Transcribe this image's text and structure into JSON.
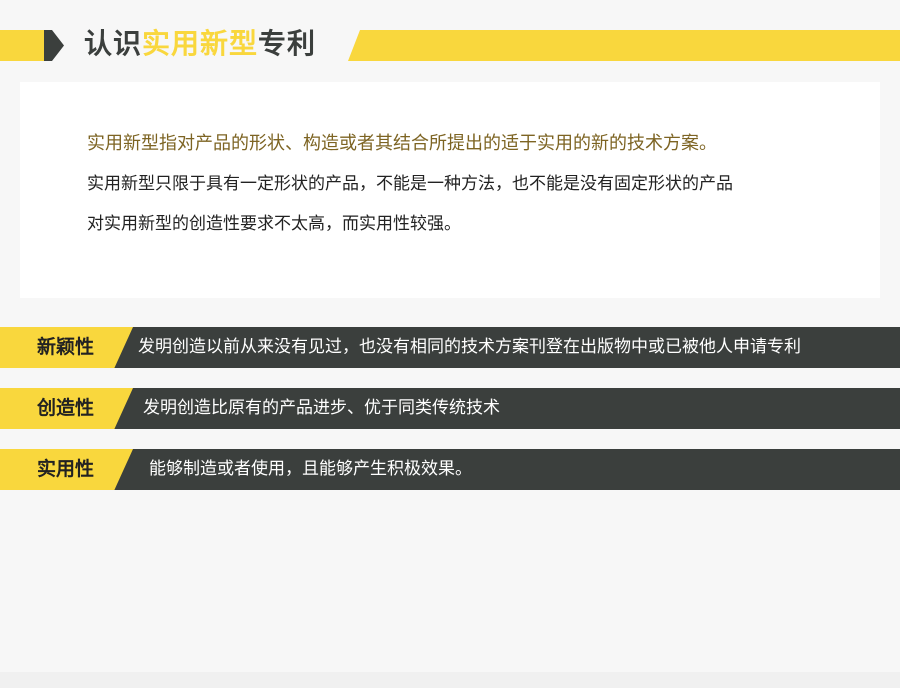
{
  "header": {
    "title_part1": "认识",
    "title_part2": "实用新型",
    "title_part3": "专利"
  },
  "intro": {
    "lines": [
      "实用新型指对产品的形状、构造或者其结合所提出的适于实用的新的技术方案。",
      "实用新型只限于具有一定形状的产品，不能是一种方法，也不能是没有固定形状的产品",
      "对实用新型的创造性要求不太高，而实用性较强。"
    ]
  },
  "features": [
    {
      "label": "新颖性",
      "description": "发明创造以前从来没有见过，也没有相同的技术方案刊登在出版物中或已被他人申请专利"
    },
    {
      "label": "创造性",
      "description": "发明创造比原有的产品进步、优于同类传统技术"
    },
    {
      "label": "实用性",
      "description": "能够制造或者使用，且能够产生积极效果。"
    }
  ],
  "colors": {
    "accent_yellow": "#f9d73d",
    "dark_gray": "#3b3f3d",
    "intro_highlight": "#7d6423"
  }
}
